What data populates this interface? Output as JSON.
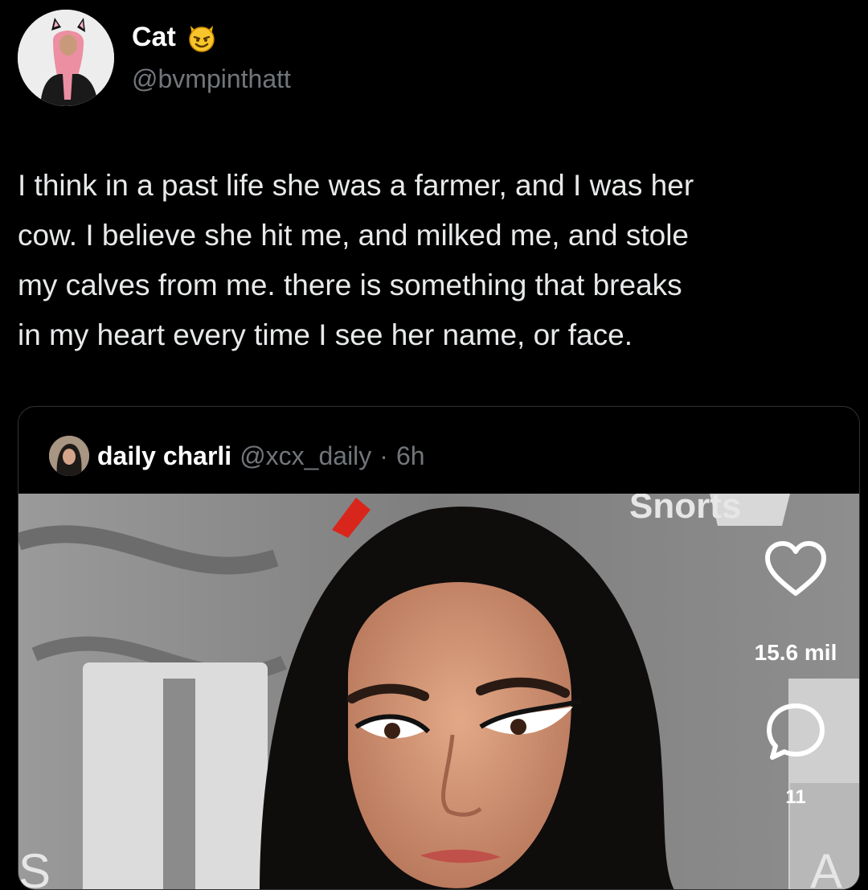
{
  "author": {
    "display_name": "Cat",
    "handle": "@bvmpinthatt",
    "emoji_icon": "smiling-cat-with-horns-emoji"
  },
  "tweet": {
    "text": "I think in a past life she was a farmer, and I was her\ncow. I believe she hit me, and milked me, and stole\nmy calves from me. there is something that breaks\nin my heart every time I see her name, or face."
  },
  "quote": {
    "name": "daily charli",
    "handle": "@xcx_daily",
    "separator": "·",
    "time": "6h",
    "media_icon": "photo-of-woman-with-dark-hair"
  },
  "actions": {
    "like": {
      "icon": "heart-outline-icon",
      "count": "15.6 mil"
    },
    "comment": {
      "icon": "speech-bubble-icon",
      "count": "11"
    }
  },
  "colors": {
    "background": "#000000",
    "text": "#e7e9ea",
    "secondary_text": "#71767b",
    "border": "#2f3336"
  }
}
